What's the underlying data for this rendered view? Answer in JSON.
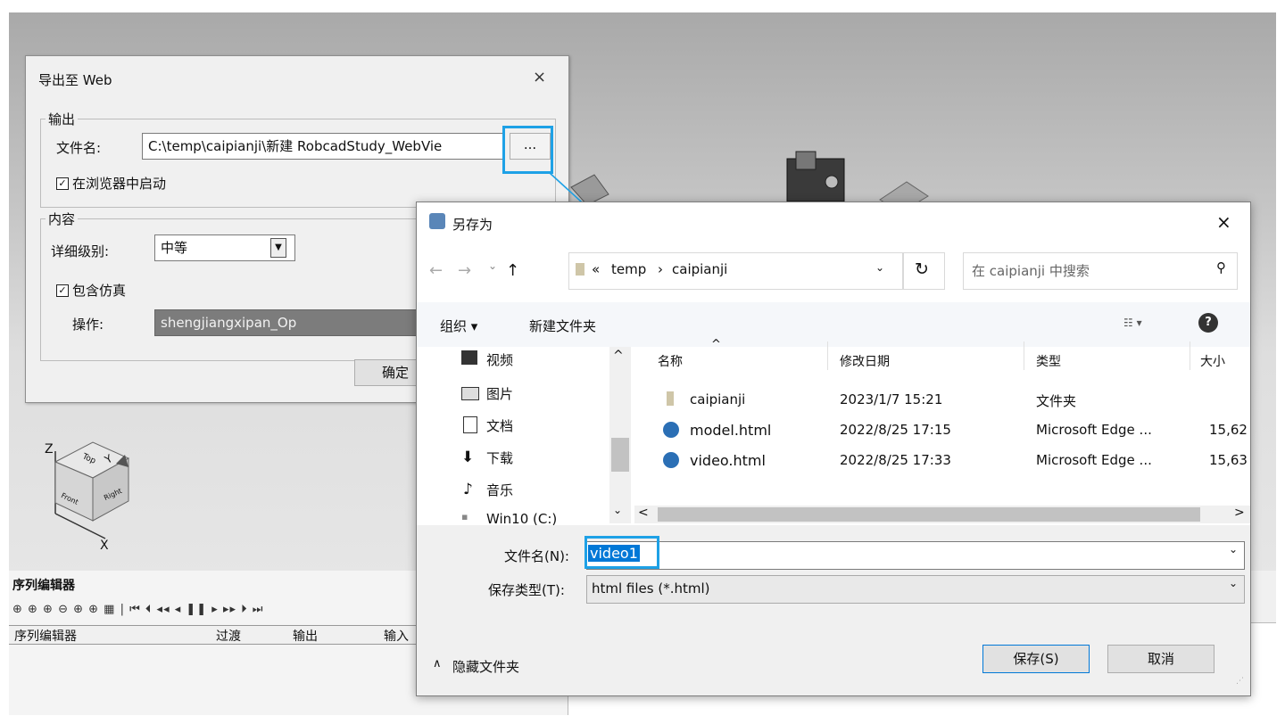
{
  "export_dialog": {
    "title": "导出至 Web",
    "close": "×",
    "output_group": "输出",
    "filename_label": "文件名:",
    "filename_value": "C:\\temp\\caipianji\\新建 RobcadStudy_WebVie",
    "browse_button": "...",
    "launch_browser_checkbox": "在浏览器中启动",
    "content_group": "内容",
    "detail_label": "详细级别:",
    "detail_value": "中等",
    "include_sim_checkbox": "包含仿真",
    "operation_label": "操作:",
    "operation_value": "shengjiangxipan_Op",
    "ok_button": "确定"
  },
  "nav_cube": {
    "top": "Top",
    "front": "Front",
    "right": "Right",
    "axis_z": "Z",
    "axis_y": "Y",
    "axis_x": "X"
  },
  "sequence_editor": {
    "title": "序列编辑器",
    "toolbar_icons": "⊕ ⊕ ⊕ ⊖ ⊕ ⊕ ▦ | ⏮ ⏴ ◂◂ ◂ ❚❚ ▸ ▸▸ ⏵ ⏭",
    "columns": [
      "序列编辑器",
      "过渡",
      "输出",
      "输入"
    ]
  },
  "save_dialog": {
    "title": "另存为",
    "close": "×",
    "nav_back": "←",
    "nav_forward": "→",
    "nav_recent": "⌄",
    "nav_up": "↑",
    "path_prefix": "«",
    "path_segments": [
      "temp",
      "caipianji"
    ],
    "path_sep": "›",
    "refresh": "↻",
    "search_placeholder": "在 caipianji 中搜索",
    "organize": "组织 ▾",
    "new_folder": "新建文件夹",
    "help": "?",
    "sidebar": [
      "视频",
      "图片",
      "文档",
      "下载",
      "音乐",
      "Win10 (C:)"
    ],
    "columns": {
      "name": "名称",
      "modified": "修改日期",
      "type": "类型",
      "size": "大小"
    },
    "files": [
      {
        "name": "caipianji",
        "modified": "2023/1/7 15:21",
        "type": "文件夹",
        "size": "",
        "icon": "folder-icon"
      },
      {
        "name": "model.html",
        "modified": "2022/8/25 17:15",
        "type": "Microsoft Edge ...",
        "size": "15,62",
        "icon": "edge-icon"
      },
      {
        "name": "video.html",
        "modified": "2022/8/25 17:33",
        "type": "Microsoft Edge ...",
        "size": "15,63",
        "icon": "edge-icon"
      }
    ],
    "filename_label": "文件名(N):",
    "filename_value": "video1",
    "filetype_label": "保存类型(T):",
    "filetype_value": "html files (*.html)",
    "hide_folders": "隐藏文件夹",
    "save_button": "保存(S)",
    "cancel_button": "取消"
  },
  "colors": {
    "highlight": "#1ea1e6",
    "selection": "#0078d7"
  }
}
